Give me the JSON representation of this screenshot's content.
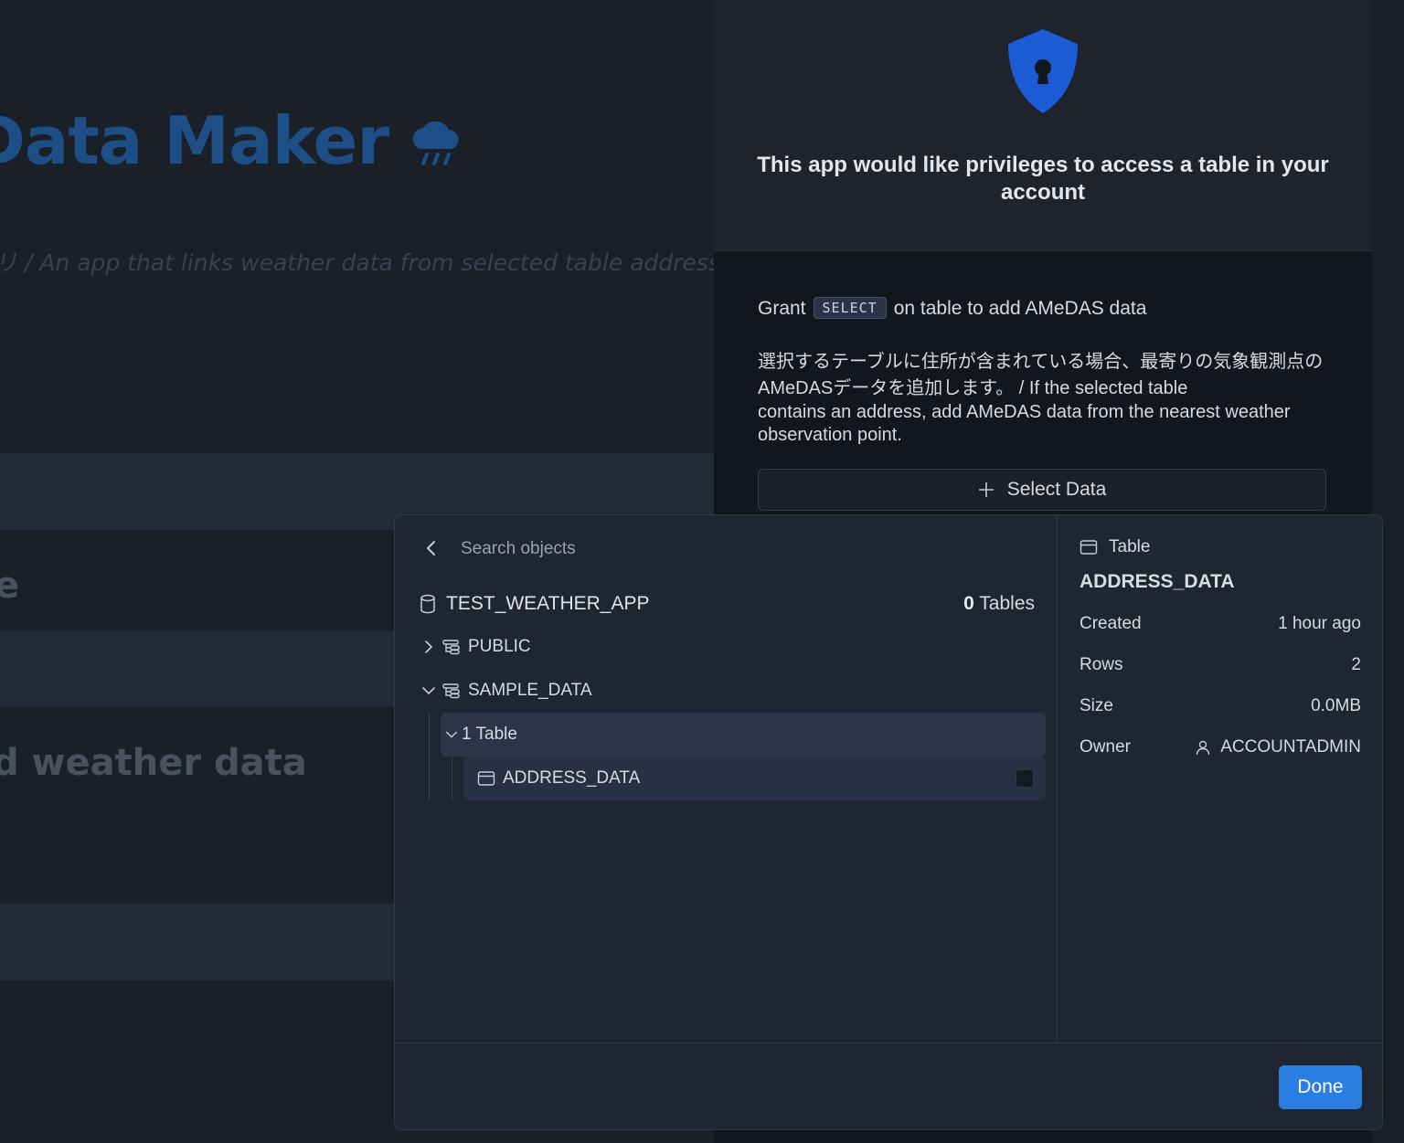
{
  "background": {
    "title": "Data Maker",
    "subtitle": "リ / An app that links weather data from selected table address dat",
    "section_text_1": "e",
    "section_text_2": "d weather data"
  },
  "privileges": {
    "title": "This app would like privileges to access a table in your account",
    "grant_prefix": "Grant",
    "grant_privilege": "SELECT",
    "grant_suffix": "on table to add AMeDAS data",
    "description_jp": "選択するテーブルに住所が含まれている場合、最寄りの気象観測点のAMeDASデータを追加します。 / If the selected table",
    "description_en": "contains an address, add AMeDAS data from the nearest weather observation point.",
    "select_button": "Select Data"
  },
  "picker": {
    "search_placeholder": "Search objects",
    "database": "TEST_WEATHER_APP",
    "table_count": "0",
    "table_count_label": "Tables",
    "schemas": [
      {
        "name": "PUBLIC",
        "expanded": false
      },
      {
        "name": "SAMPLE_DATA",
        "expanded": true
      }
    ],
    "group_label": "1 Table",
    "table_name": "ADDRESS_DATA",
    "done_button": "Done"
  },
  "details": {
    "type": "Table",
    "name": "ADDRESS_DATA",
    "rows": [
      {
        "label": "Created",
        "value": "1 hour ago"
      },
      {
        "label": "Rows",
        "value": "2"
      },
      {
        "label": "Size",
        "value": "0.0MB"
      },
      {
        "label": "Owner",
        "value": "ACCOUNTADMIN"
      }
    ]
  },
  "colors": {
    "accent": "#2a7de1",
    "shield": "#1b5bd3",
    "title_blue": "#1d4f86"
  }
}
